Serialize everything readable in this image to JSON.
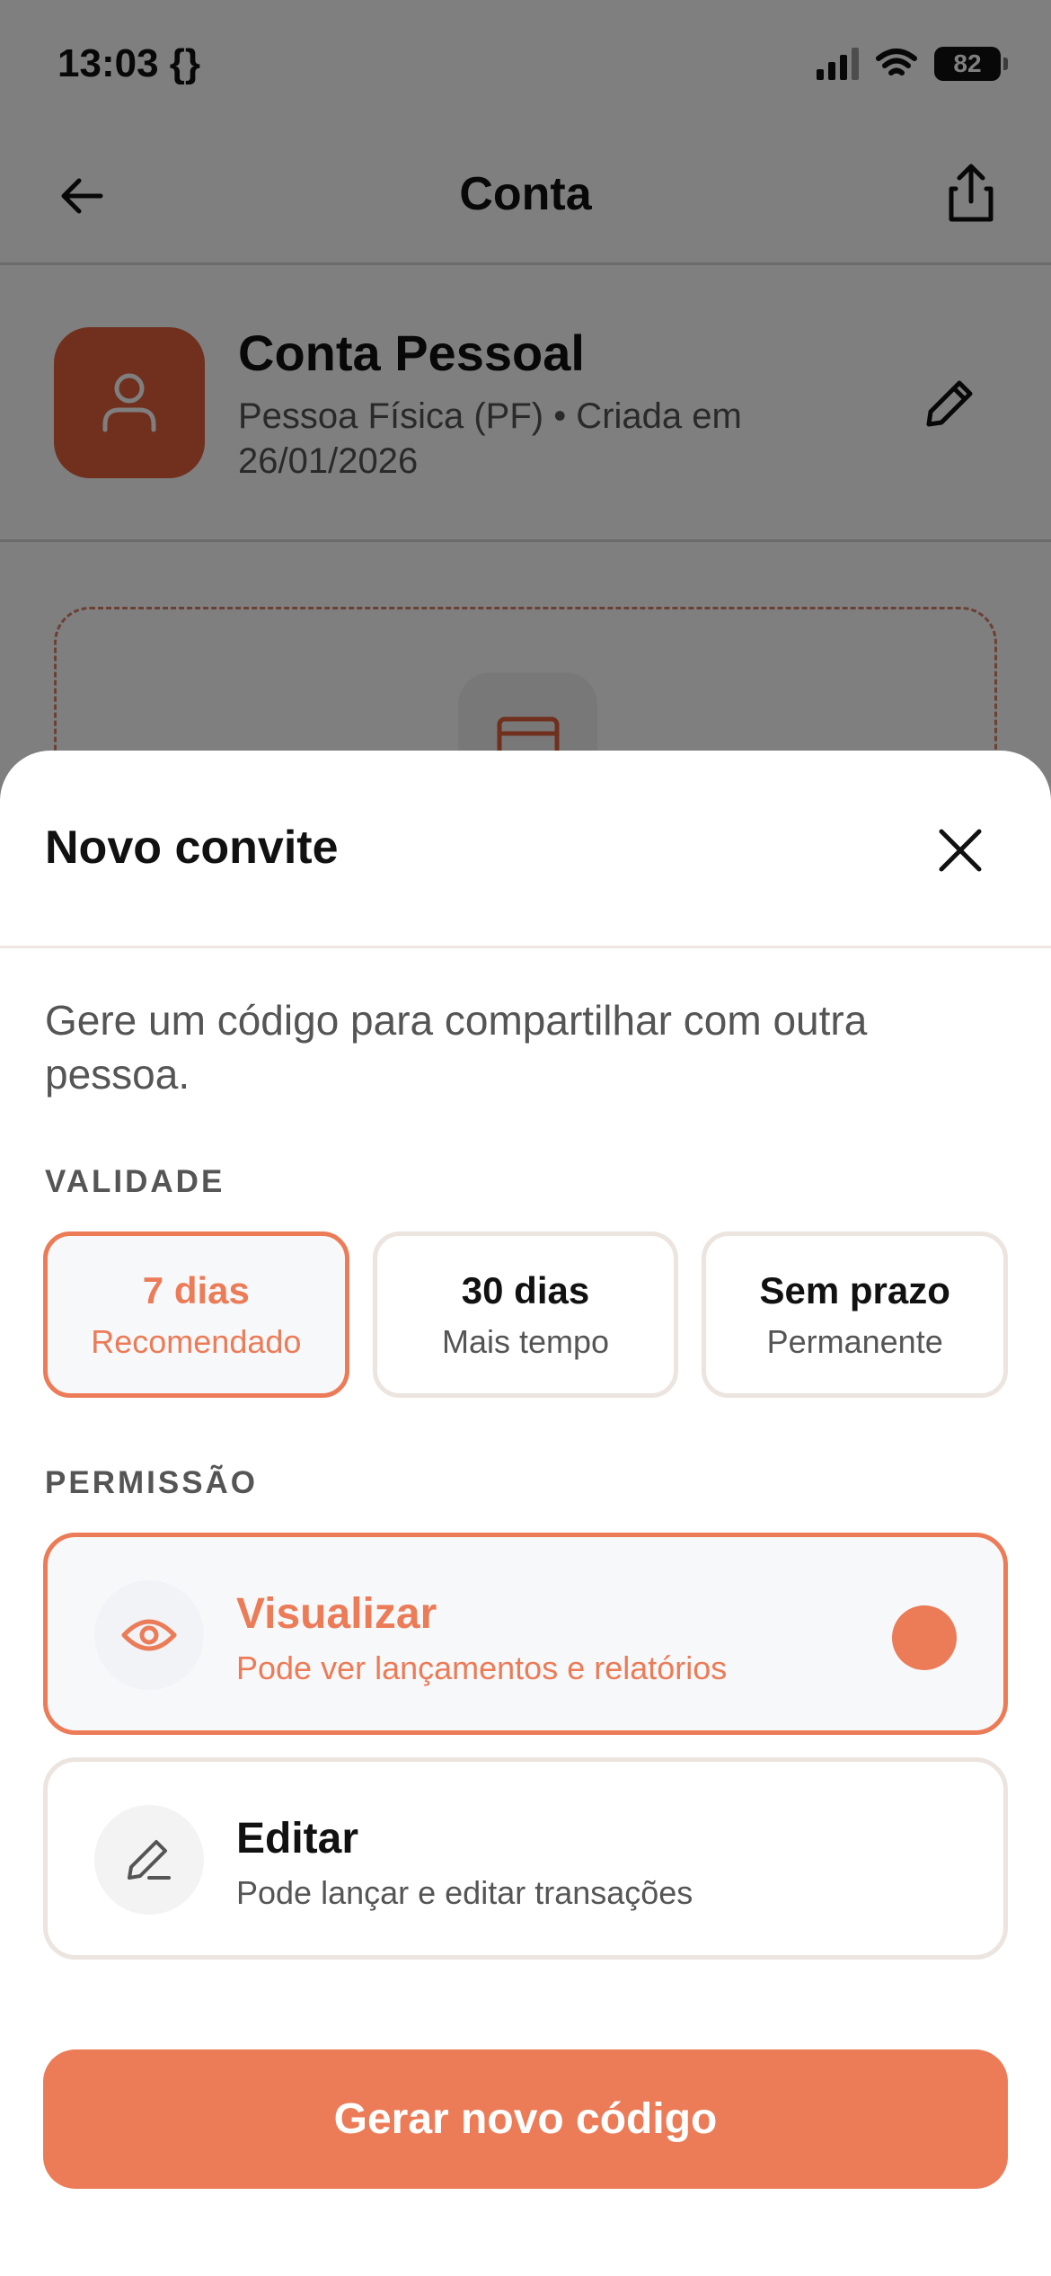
{
  "status_bar": {
    "time": "13:03 {}",
    "battery": "82"
  },
  "header": {
    "title": "Conta"
  },
  "account": {
    "name": "Conta Pessoal",
    "meta_line1": "Pessoa Física (PF) • Criada em",
    "meta_line2": "26/01/2026"
  },
  "sheet": {
    "title": "Novo convite",
    "description": "Gere um código para compartilhar com outra pessoa.",
    "validity_label": "VALIDADE",
    "validity_options": [
      {
        "title": "7 dias",
        "subtitle": "Recomendado"
      },
      {
        "title": "30 dias",
        "subtitle": "Mais tempo"
      },
      {
        "title": "Sem prazo",
        "subtitle": "Permanente"
      }
    ],
    "permission_label": "PERMISSÃO",
    "permissions": [
      {
        "title": "Visualizar",
        "subtitle": "Pode ver lançamentos e relatórios"
      },
      {
        "title": "Editar",
        "subtitle": "Pode lançar e editar transações"
      }
    ],
    "generate_button": "Gerar novo código"
  },
  "colors": {
    "accent": "#ec7b57",
    "avatar": "#e0603a",
    "border": "#ece4df"
  },
  "selection": {
    "validity": "7 dias",
    "permission": "Visualizar"
  },
  "icons": {
    "back": "arrow-left-icon",
    "share": "share-icon",
    "avatar": "user-icon",
    "edit": "pencil-icon",
    "close": "close-icon",
    "view": "eye-icon",
    "edit_permission": "pencil-line-icon"
  }
}
